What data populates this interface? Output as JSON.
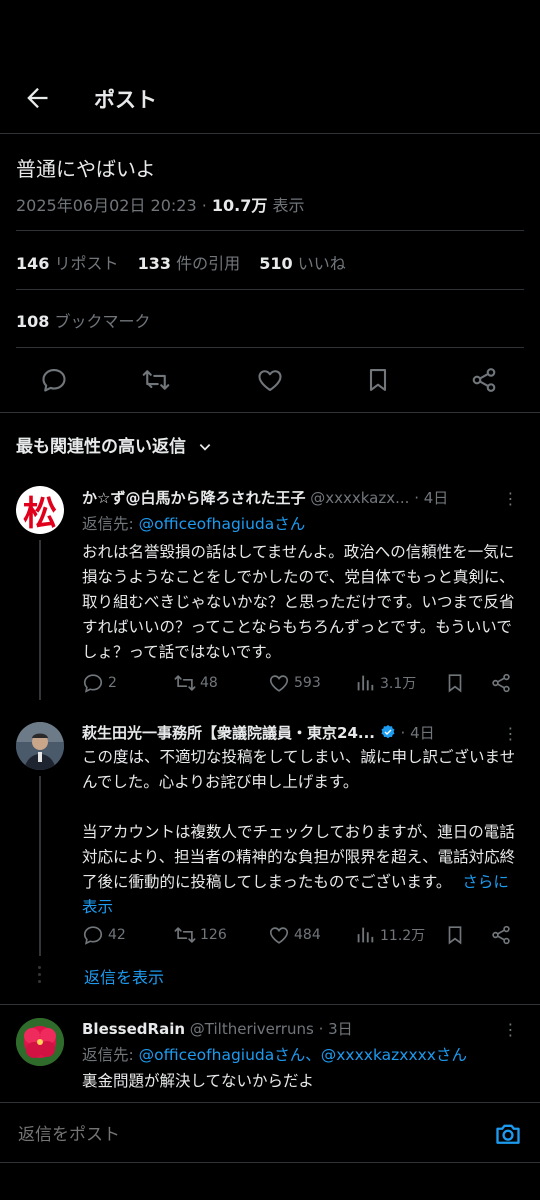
{
  "header": {
    "title": "ポスト"
  },
  "post": {
    "text": "普通にやばいよ",
    "datetime": "2025年06月02日 20:23 · ",
    "views_count": "10.7万",
    "views_label": " 表示",
    "reposts_count": "146",
    "reposts_label": "リポスト",
    "quotes_count": "133",
    "quotes_label": "件の引用",
    "likes_count": "510",
    "likes_label": "いいね",
    "bookmarks_count": "108",
    "bookmarks_label": "ブックマーク"
  },
  "sort": {
    "label": "最も関連性の高い返信"
  },
  "replies": [
    {
      "name": "か☆ず@白馬から降ろされた王子",
      "handle": "@xxxxkazx...",
      "time": "· 4日",
      "avatar_char": "松",
      "reply_to_prefix": "返信先: ",
      "reply_to": "@officeofhagiudaさん",
      "body": "おれは名誉毀損の話はしてませんよ。政治への信頼性を一気に損なうようなことをしでかしたので、党自体でもっと真剣に、取り組むべきじゃないかな？と思っただけです。いつまで反省すればいいの？ってことならもちろんずっとです。もういいでしょ？って話ではないです。",
      "replies": "2",
      "retweets": "48",
      "likes": "593",
      "views": "3.1万"
    },
    {
      "name": "萩生田光一事務所【衆議院議員・東京24...",
      "handle": "",
      "time": "· 4日",
      "body1": "この度は、不適切な投稿をしてしまい、誠に申し訳ございませんでした。心よりお詫び申し上げます。",
      "body2": "当アカウントは複数人でチェックしておりますが、連日の電話対応により、担当者の精神的な負担が限界を超え、電話対応終了後に衝動的に投稿してしまったものでございます。",
      "show_more": "さらに表示",
      "replies": "42",
      "retweets": "126",
      "likes": "484",
      "views": "11.2万",
      "show_replies": "返信を表示"
    },
    {
      "name": "BlessedRain",
      "handle": "@Tiltheriverruns",
      "time": "· 3日",
      "reply_to_prefix": "返信先: ",
      "reply_to": "@officeofhagiudaさん、@xxxxkazxxxxさん",
      "body": "裏金問題が解決してないからだよ"
    }
  ],
  "composer": {
    "placeholder": "返信をポスト"
  },
  "colors": {
    "accent": "#1d9bf0",
    "verified": "#1d9bf0",
    "muted": "#71767b"
  }
}
